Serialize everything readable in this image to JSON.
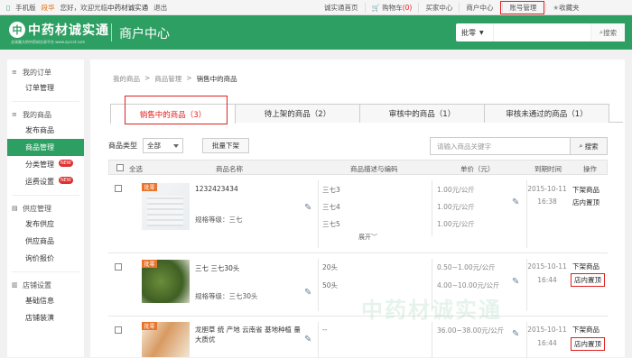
{
  "topbar": {
    "phone": "手机版",
    "user": "段华",
    "welcome": "您好，欢迎光临",
    "site": "中药材诚实通",
    "logout": "退出",
    "links": [
      "诚实通首页",
      "购物车",
      "(0)",
      "买家中心",
      "商户中心",
      "账号管理",
      "收藏夹"
    ]
  },
  "header": {
    "logo": "中药材诚实通",
    "logo_sub": "全球最大的中药材交易平台 www.zyccst.com",
    "title": "商户中心",
    "search_select": "批零",
    "search_button": "搜索"
  },
  "sidebar": {
    "groups": [
      {
        "title": "我的订单",
        "items": [
          "订单管理"
        ]
      },
      {
        "title": "我的商品",
        "items": [
          "发布商品",
          "商品管理",
          "分类管理",
          "运费设置"
        ]
      },
      {
        "title": "供应管理",
        "items": [
          "发布供应",
          "供应商品",
          "询价报价"
        ]
      },
      {
        "title": "店铺设置",
        "items": [
          "基础信息",
          "店铺装潢"
        ]
      }
    ],
    "new_badge": "NEW"
  },
  "breadcrumb": [
    "我的商品",
    ">",
    "商品管理",
    ">",
    "销售中的商品"
  ],
  "tabs": [
    {
      "label": "销售中的商品（3）"
    },
    {
      "label": "待上架的商品（2）"
    },
    {
      "label": "审核中的商品（1）"
    },
    {
      "label": "审核未通过的商品（1）"
    }
  ],
  "filter": {
    "type_label": "商品类型",
    "type_value": "全部",
    "bulk_button": "批量下架",
    "search_placeholder": "请输入商品关键字",
    "search_button": "搜索"
  },
  "table": {
    "headers": [
      "全选",
      "商品名称",
      "商品描述与编码",
      "单价（元）",
      "到期时间",
      "操作"
    ],
    "rows": [
      {
        "badge": "批零",
        "name": "1232423434",
        "spec": "规格等级：三七",
        "descs": [
          "三七3",
          "三七4",
          "三七5"
        ],
        "more": "展开",
        "prices": [
          "1.00元/公斤",
          "1.00元/公斤",
          "1.00元/公斤"
        ],
        "date": "2015-10-11",
        "time": "16:38",
        "ops": [
          "下架商品",
          "店内置顶"
        ]
      },
      {
        "badge": "批零",
        "name": "三七 三七30头",
        "spec": "规格等级：三七30头",
        "descs": [
          "20头",
          "50头"
        ],
        "prices": [
          "0.50~1.00元/公斤",
          "4.00~10.00元/公斤"
        ],
        "date": "2015-10-11",
        "time": "16:44",
        "ops": [
          "下架商品",
          "店内置顶"
        ]
      },
      {
        "badge": "批零",
        "name": "龙胆草 统 产地 云南省 基地种植 量大质优",
        "descs": [
          "--"
        ],
        "prices": [
          "36.00~38.00元/公斤"
        ],
        "date": "2015-10-11",
        "time": "16:44",
        "ops": [
          "下架商品",
          "店内置顶"
        ]
      }
    ]
  },
  "watermark": "中药材诚实通"
}
